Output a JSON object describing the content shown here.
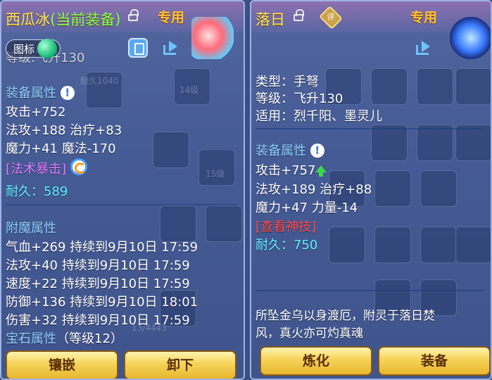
{
  "left": {
    "title_name": "西瓜冰",
    "title_status": "(当前装备)",
    "exclusive_tag": "专用",
    "icon_toggle_label": "图标",
    "partial_line": "等级:飞升130",
    "ghost_text": [
      "耐久1040",
      "14级",
      "15级",
      "13/4443"
    ],
    "attr_header": "装备属性",
    "info_symbol": "!",
    "stats": [
      "攻击+752",
      "法攻+188 治疗+83",
      "魔力+41 魔法-170"
    ],
    "special": "[法术暴击]",
    "durability": "耐久：589",
    "enchant_header": "附魔属性",
    "enchants": [
      "气血+269 持续到9月10日 17:59",
      "法攻+40 持续到9月10日 17:59",
      "速度+22 持续到9月10日 17:59",
      "防御+136 持续到9月10日 18:01",
      "伤害+32 持续到9月10日 17:59"
    ],
    "gem_header": "宝石属性",
    "gem_level": "（等级12）",
    "buttons": [
      "镶嵌",
      "卸下"
    ]
  },
  "right": {
    "title_name": "落日",
    "rating_badge": "评",
    "exclusive_tag": "专用",
    "type_line": "类型：手弩",
    "level_line": "等级：飞升130",
    "fit_line": "适用：烈千阳、墨灵儿",
    "attr_header": "装备属性",
    "info_symbol": "!",
    "stat_attack": "攻击+757",
    "stats": [
      "法攻+189 治疗+88",
      "魔力+47 力量-14"
    ],
    "special": "[查看神技]",
    "durability": "耐久：750",
    "description": [
      "所坠金乌以身渡厄，附灵于落日焚",
      "风，真火亦可灼真魂"
    ],
    "buttons": [
      "炼化",
      "装备"
    ]
  },
  "colors": {
    "title": "#ffe65a",
    "status_green": "#8cff5a",
    "header_blue": "#8fd0ff",
    "durability_cyan": "#5ff0ff",
    "skill_purple": "#e07aff",
    "skill_red": "#ff4a4a",
    "button_gold": "#f5d358",
    "arrow_green": "#3cd84a"
  },
  "icons": [
    "lock-icon",
    "rating-badge-icon",
    "share-icon",
    "attribute-panel-icon",
    "toggle-knob",
    "info-icon",
    "refresh-icon",
    "up-arrow-icon",
    "item-artwork"
  ]
}
